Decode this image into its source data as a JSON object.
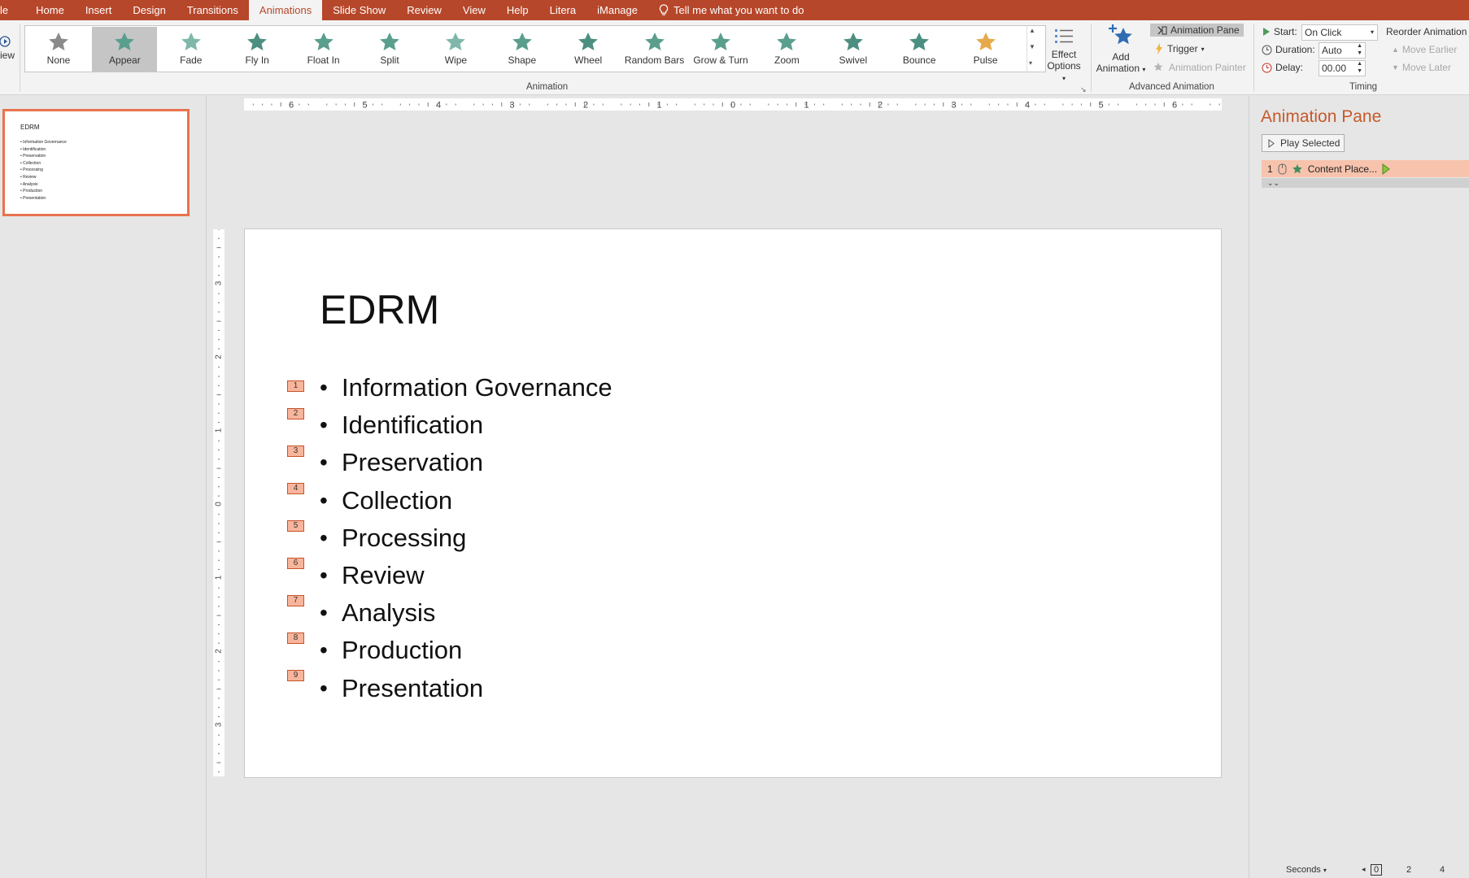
{
  "menu": {
    "file_partial": "le",
    "tabs": [
      "Home",
      "Insert",
      "Design",
      "Transitions",
      "Animations",
      "Slide Show",
      "Review",
      "View",
      "Help",
      "Litera",
      "iManage"
    ],
    "tell_me": "Tell me what you want to do"
  },
  "ribbon": {
    "preview_partial": "iew",
    "gallery": [
      {
        "label": "None",
        "color": "#8a8a8a"
      },
      {
        "label": "Appear",
        "color": "#5a9e8e"
      },
      {
        "label": "Fade",
        "color": "#7fb8aa"
      },
      {
        "label": "Fly In",
        "color": "#4c8f80"
      },
      {
        "label": "Float In",
        "color": "#5a9e8e"
      },
      {
        "label": "Split",
        "color": "#5a9e8e"
      },
      {
        "label": "Wipe",
        "color": "#7fb8aa"
      },
      {
        "label": "Shape",
        "color": "#5a9e8e"
      },
      {
        "label": "Wheel",
        "color": "#4c8f80"
      },
      {
        "label": "Random Bars",
        "color": "#5a9e8e"
      },
      {
        "label": "Grow & Turn",
        "color": "#5a9e8e"
      },
      {
        "label": "Zoom",
        "color": "#5a9e8e"
      },
      {
        "label": "Swivel",
        "color": "#4c8f80"
      },
      {
        "label": "Bounce",
        "color": "#4c8f80"
      },
      {
        "label": "Pulse",
        "color": "#e6a94a"
      }
    ],
    "effect_options_line1": "Effect",
    "effect_options_line2": "Options",
    "animation_group": "Animation",
    "add_animation_line1": "Add",
    "add_animation_line2": "Animation",
    "animation_pane_btn": "Animation Pane",
    "trigger": "Trigger",
    "animation_painter": "Animation Painter",
    "advanced_group": "Advanced Animation",
    "start_label": "Start:",
    "start_value": "On Click",
    "duration_label": "Duration:",
    "duration_value": "Auto",
    "delay_label": "Delay:",
    "delay_value": "00.00",
    "timing_group": "Timing",
    "reorder_label": "Reorder Animation",
    "move_earlier": "Move Earlier",
    "move_later": "Move Later"
  },
  "thumbnail": {
    "title": "EDRM",
    "bullets": [
      "• Information Governance",
      "• Identification",
      "• Preservation",
      "• Collection",
      "• Processing",
      "• Review",
      "• Analysis",
      "• Production",
      "• Presentation"
    ]
  },
  "ruler": {
    "h_labels": [
      "6",
      "5",
      "4",
      "3",
      "2",
      "1",
      "0",
      "1",
      "2",
      "3",
      "4",
      "5",
      "6"
    ],
    "v_labels": [
      "3",
      "2",
      "1",
      "0",
      "1",
      "2",
      "3"
    ]
  },
  "slide": {
    "title": "EDRM",
    "bullets": [
      "Information Governance",
      "Identification",
      "Preservation",
      "Collection",
      "Processing",
      "Review",
      "Analysis",
      "Production",
      "Presentation"
    ],
    "tags": [
      "1",
      "2",
      "3",
      "4",
      "5",
      "6",
      "7",
      "8",
      "9"
    ]
  },
  "anim_pane": {
    "title": "Animation Pane",
    "play_selected": "Play Selected",
    "item_number": "1",
    "item_label": "Content Place..."
  },
  "timeline": {
    "unit": "Seconds",
    "ticks": [
      "0",
      "2",
      "4"
    ]
  },
  "colors": {
    "accent": "#b7472a",
    "pane_title": "#c55a2a",
    "anim_tag_fill": "#f8b59b",
    "selection_border": "#e8734e"
  }
}
